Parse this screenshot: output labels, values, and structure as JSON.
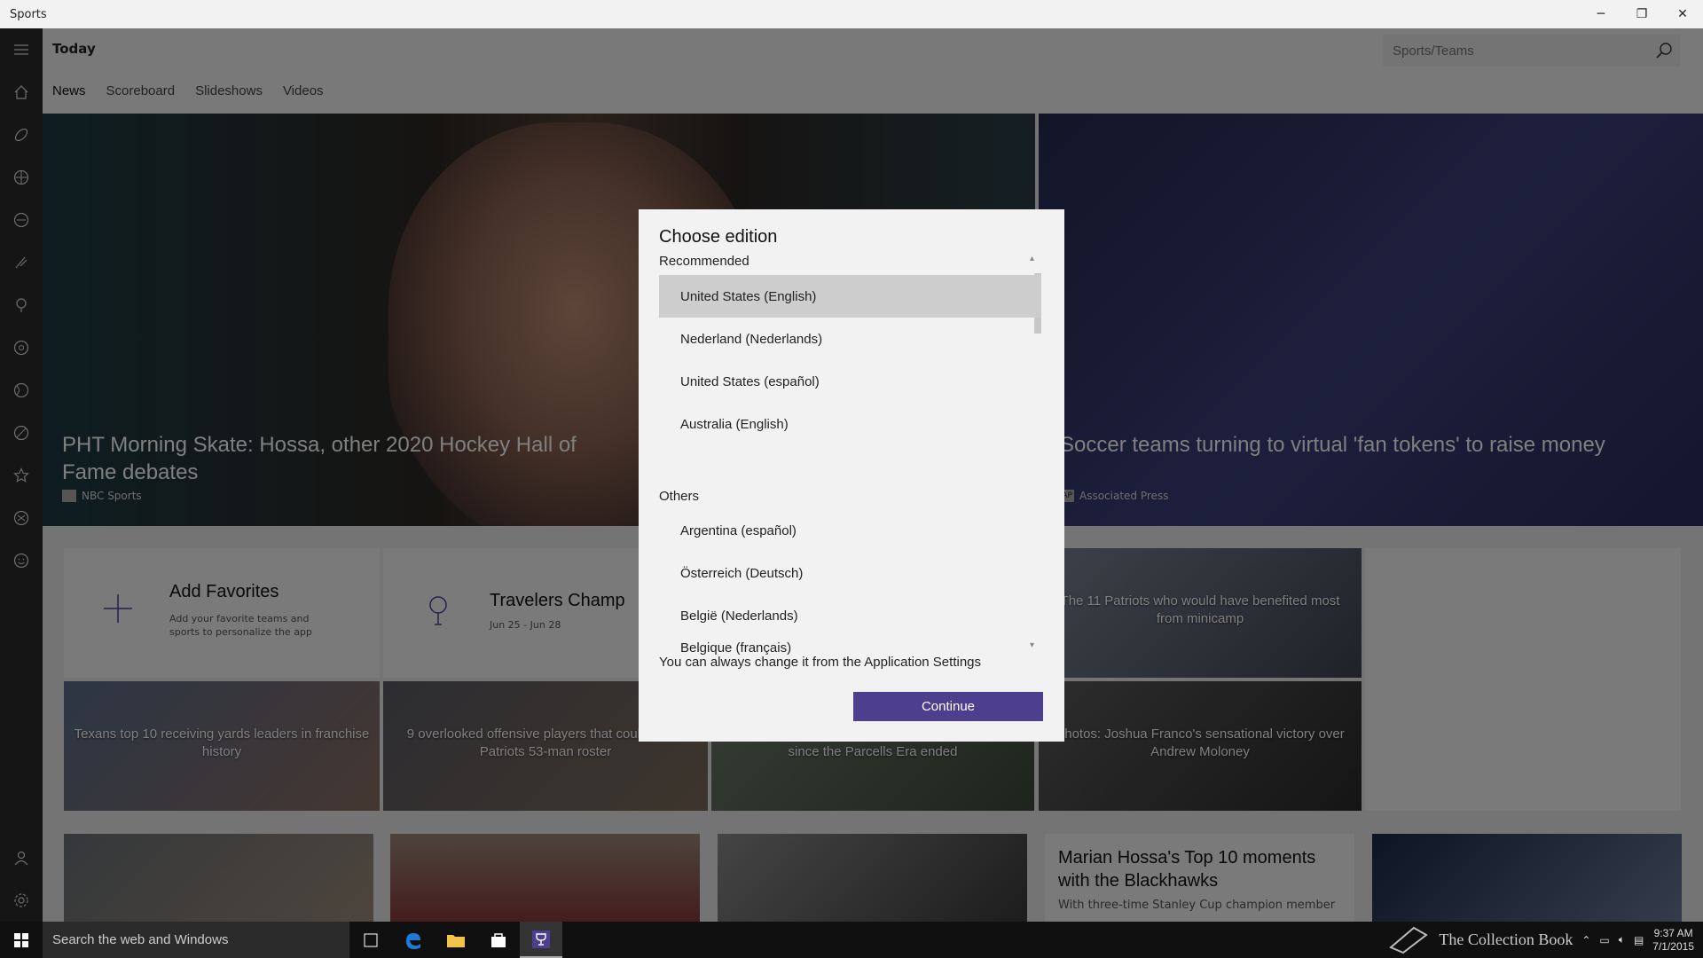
{
  "window": {
    "title": "Sports",
    "minimize": "─",
    "restore": "❐",
    "close": "✕"
  },
  "header": {
    "page_title": "Today",
    "search_placeholder": "Sports/Teams",
    "tabs": [
      {
        "label": "News"
      },
      {
        "label": "Scoreboard"
      },
      {
        "label": "Slideshows"
      },
      {
        "label": "Videos"
      }
    ]
  },
  "hero": {
    "left": {
      "headline": "PHT Morning Skate: Hossa, other 2020 Hockey Hall of Fame debates",
      "source": "NBC Sports"
    },
    "right": {
      "headline": "Soccer teams turning to virtual 'fan tokens' to raise money",
      "source": "Associated Press",
      "source_logo": "AP"
    }
  },
  "tiles": {
    "add_favorites": {
      "title": "Add Favorites",
      "subtitle": "Add your favorite teams and sports to personalize the app"
    },
    "travelers": {
      "title": "Travelers Champ",
      "dates": "Jun 25 - Jun 28"
    },
    "patriots_minicamp": "The 11 Patriots who would have benefited most from minicamp",
    "texans": "Texans top 10 receiving yards leaders in franchise history",
    "overlooked": "9 overlooked offensive players that could make Patriots 53-man roster",
    "parcells": "since the Parcells Era ended",
    "franco": "Photos: Joshua Franco's sensational victory over Andrew Moloney",
    "hossa_moments": {
      "title": "Marian Hossa's Top 10 moments with the Blackhawks",
      "snippet": "With three-time Stanley Cup champion member"
    }
  },
  "dialog": {
    "title": "Choose edition",
    "recommended_label": "Recommended",
    "recommended": [
      {
        "label": "United States (English)",
        "selected": true
      },
      {
        "label": "Nederland (Nederlands)"
      },
      {
        "label": "United States (español)"
      },
      {
        "label": "Australia (English)"
      }
    ],
    "others_label": "Others",
    "others": [
      {
        "label": "Argentina (español)"
      },
      {
        "label": "Österreich (Deutsch)"
      },
      {
        "label": "België (Nederlands)"
      },
      {
        "label": "Belgique (français)"
      }
    ],
    "hint": "You can always change it from the Application Settings",
    "continue_label": "Continue"
  },
  "taskbar": {
    "search_placeholder": "Search the web and Windows",
    "tray_text": "The Collection Book",
    "time": "9:37 AM",
    "date": "7/1/2015"
  },
  "colors": {
    "accent": "#4d3f8e",
    "rail": "#2b2b2b",
    "taskbar": "#101010"
  }
}
